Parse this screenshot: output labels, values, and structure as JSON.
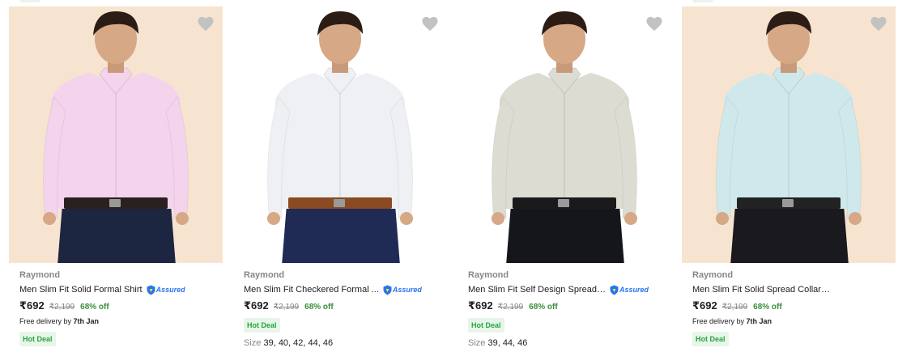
{
  "products": [
    {
      "brand": "Raymond",
      "title": "Men Slim Fit Solid Formal Shirt",
      "assured": true,
      "price": "₹692",
      "mrp": "₹2,199",
      "discount": "68% off",
      "delivery_prefix": "Free delivery by ",
      "delivery_date": "7th Jan",
      "deal": "Hot Deal",
      "sizes_label": "",
      "sizes": "",
      "bg_color": "#f7e4d0",
      "shirt_color": "#f4d3ec",
      "pants_color": "#1d2640",
      "belt_color": "#2a2020"
    },
    {
      "brand": "Raymond",
      "title": "Men Slim Fit Checkered Formal ...",
      "assured": true,
      "price": "₹692",
      "mrp": "₹2,199",
      "discount": "68% off",
      "delivery_prefix": "",
      "delivery_date": "",
      "deal": "Hot Deal",
      "sizes_label": "Size",
      "sizes": "39, 40, 42, 44, 46",
      "bg_color": "#ffffff",
      "shirt_color": "#eef0f4",
      "pants_color": "#1f2a55",
      "belt_color": "#8a4a22"
    },
    {
      "brand": "Raymond",
      "title": "Men Slim Fit Self Design Spread ...",
      "assured": true,
      "price": "₹692",
      "mrp": "₹2,199",
      "discount": "68% off",
      "delivery_prefix": "",
      "delivery_date": "",
      "deal": "Hot Deal",
      "sizes_label": "Size",
      "sizes": "39, 44, 46",
      "bg_color": "#ffffff",
      "shirt_color": "#dcdcd2",
      "pants_color": "#14161c",
      "belt_color": "#1a1a1a"
    },
    {
      "brand": "Raymond",
      "title": "Men Slim Fit Solid Spread Collar Formal Shirt",
      "assured": false,
      "price": "₹692",
      "mrp": "₹2,199",
      "discount": "68% off",
      "delivery_prefix": "Free delivery by ",
      "delivery_date": "7th Jan",
      "deal": "Hot Deal",
      "sizes_label": "",
      "sizes": "",
      "bg_color": "#f7e4d0",
      "shirt_color": "#cfe8ec",
      "pants_color": "#1a1a1e",
      "belt_color": "#222222"
    }
  ],
  "assured_label": "Assured",
  "colors": {
    "accent_blue": "#2874f0",
    "discount_green": "#388e3c",
    "deal_bg": "#e8f5e9",
    "wishlist_gray": "#c2c2c2"
  }
}
